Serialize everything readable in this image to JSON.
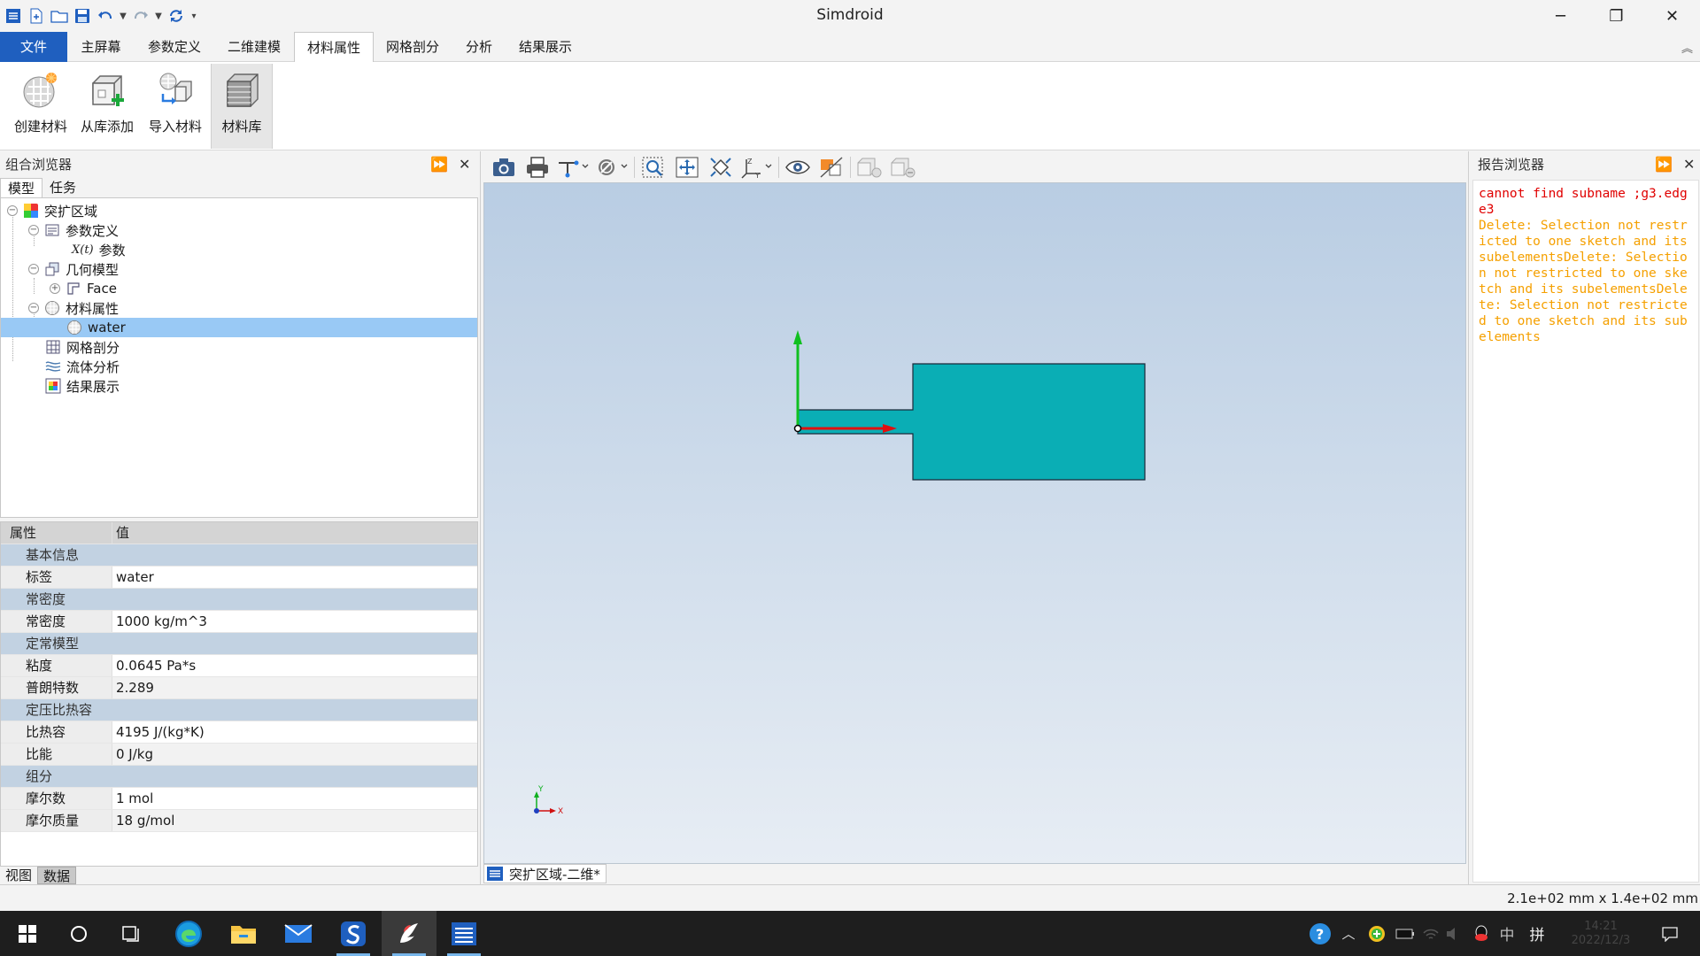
{
  "window": {
    "title": "Simdroid",
    "minimize_glyph": "─",
    "maximize_glyph": "❐",
    "close_glyph": "✕"
  },
  "quick_access": [
    "app-icon",
    "new-icon",
    "open-folder-icon",
    "save-icon",
    "undo-icon",
    "redo-icon",
    "refresh-icon",
    "customize-icon"
  ],
  "menu": {
    "file": "文件",
    "tabs": [
      "主屏幕",
      "参数定义",
      "二维建模",
      "材料属性",
      "网格剖分",
      "分析",
      "结果展示"
    ],
    "active_tab": "材料属性"
  },
  "ribbon": {
    "buttons": [
      {
        "label": "创建材料",
        "icon": "create-material-icon"
      },
      {
        "label": "从库添加",
        "icon": "add-from-library-icon"
      },
      {
        "label": "导入材料",
        "icon": "import-material-icon"
      },
      {
        "label": "材料库",
        "icon": "material-library-icon"
      }
    ]
  },
  "left_panel": {
    "title": "组合浏览器",
    "tabs": [
      "模型",
      "任务"
    ],
    "tree": [
      {
        "label": "突扩区域",
        "level": 0
      },
      {
        "label": "参数定义",
        "level": 1
      },
      {
        "label": "参数",
        "level": 2
      },
      {
        "label": "几何模型",
        "level": 1
      },
      {
        "label": "Face",
        "level": 2
      },
      {
        "label": "材料属性",
        "level": 1
      },
      {
        "label": "water",
        "level": 2,
        "selected": true
      },
      {
        "label": "网格剖分",
        "level": 1
      },
      {
        "label": "流体分析",
        "level": 1
      },
      {
        "label": "结果展示",
        "level": 1
      }
    ],
    "param_prefix": "X(t)",
    "properties": {
      "header": [
        "属性",
        "值"
      ],
      "rows": [
        {
          "type": "group",
          "name": "基本信息"
        },
        {
          "type": "item",
          "name": "标签",
          "value": "water"
        },
        {
          "type": "group",
          "name": "常密度"
        },
        {
          "type": "item",
          "name": "常密度",
          "value": "1000 kg/m^3"
        },
        {
          "type": "group",
          "name": "定常模型"
        },
        {
          "type": "item",
          "name": "粘度",
          "value": "0.0645 Pa*s"
        },
        {
          "type": "item",
          "name": "普朗特数",
          "value": "2.289"
        },
        {
          "type": "group",
          "name": "定压比热容"
        },
        {
          "type": "item",
          "name": "比热容",
          "value": "4195 J/(kg*K)"
        },
        {
          "type": "item",
          "name": "比能",
          "value": "0 J/kg"
        },
        {
          "type": "group",
          "name": "组分"
        },
        {
          "type": "item",
          "name": "摩尔数",
          "value": "1 mol"
        },
        {
          "type": "item",
          "name": "摩尔质量",
          "value": "18 g/mol"
        }
      ]
    },
    "bottom_tabs": [
      "视图",
      "数据"
    ]
  },
  "viewport": {
    "doc_tab": "突扩区域-二维*",
    "shape_color": "#0aaeb5",
    "axis_x_color": "#e01010",
    "axis_y_color": "#10c020",
    "triad": {
      "x": "X",
      "y": "Y"
    }
  },
  "right_panel": {
    "title": "报告浏览器",
    "messages": [
      {
        "kind": "error",
        "text": "cannot find subname ;g3.edge3"
      },
      {
        "kind": "warning",
        "text": "Delete: Selection not restricted to one sketch and its subelementsDelete: Selection not restricted to one sketch and its subelementsDelete: Selection not restricted to one sketch and its subelements"
      }
    ]
  },
  "status": {
    "dimensions": "2.1e+02 mm x 1.4e+02 mm"
  },
  "taskbar": {
    "apps": [
      "windows-start-icon",
      "cortana-icon",
      "task-view-icon",
      "edge-icon",
      "file-explorer-icon",
      "mail-icon",
      "simdroid-s-icon",
      "feather-app-icon",
      "simdroid-app-icon"
    ],
    "tray": {
      "ime_mode": "中",
      "ime_layout": "拼",
      "time": "14:21",
      "date": "2022/12/3"
    }
  }
}
